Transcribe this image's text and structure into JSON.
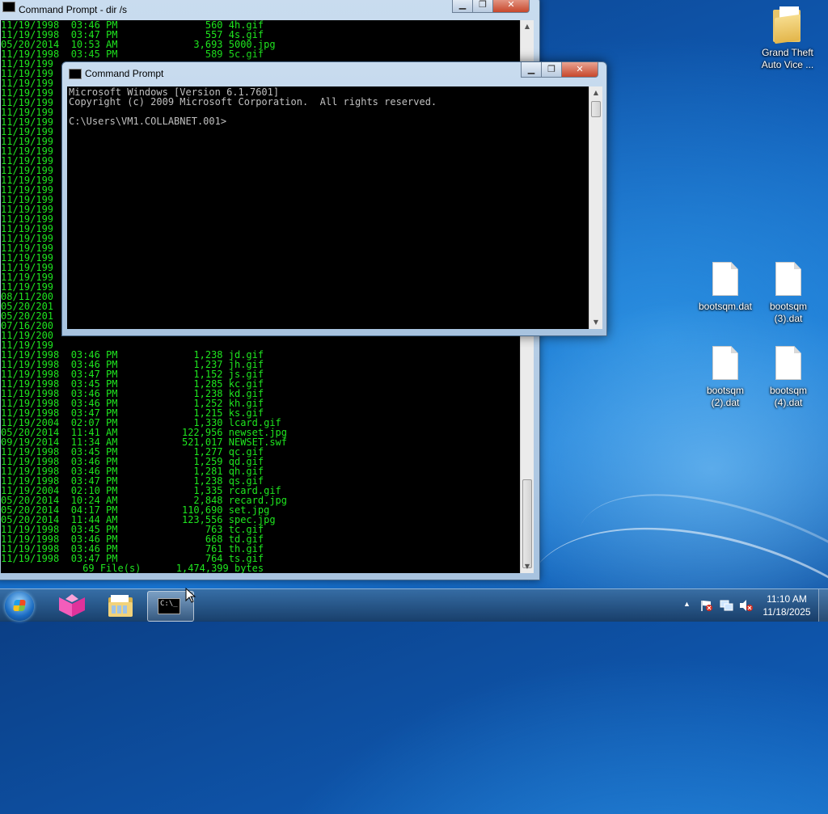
{
  "desktop": {
    "icons": [
      {
        "name": "folder-gta",
        "label": "Grand Theft Auto Vice ..."
      },
      {
        "name": "file-bootsqm",
        "label": "bootsqm.dat"
      },
      {
        "name": "file-bootsqm-3",
        "label": "bootsqm (3).dat"
      },
      {
        "name": "file-bootsqm-2",
        "label": "bootsqm (2).dat"
      },
      {
        "name": "file-bootsqm-4",
        "label": "bootsqm (4).dat"
      }
    ]
  },
  "window_back": {
    "title": "Command Prompt - dir /s",
    "colors": {
      "text": "#1fe61f",
      "background": "#000000"
    },
    "top_rows": [
      "11/19/1998  03:46 PM               560 4h.gif",
      "11/19/1998  03:47 PM               557 4s.gif",
      "05/20/2014  10:53 AM             3,693 5000.jpg",
      "11/19/1998  03:45 PM               589 5c.gif"
    ],
    "left_stubs": [
      "11/19/199",
      "11/19/199",
      "11/19/199",
      "11/19/199",
      "11/19/199",
      "11/19/199",
      "11/19/199",
      "11/19/199",
      "11/19/199",
      "11/19/199",
      "11/19/199",
      "11/19/199",
      "11/19/199",
      "11/19/199",
      "11/19/199",
      "11/19/199",
      "11/19/199",
      "11/19/199",
      "11/19/199",
      "11/19/199",
      "11/19/199",
      "11/19/199",
      "11/19/199",
      "11/19/199",
      "08/11/200",
      "05/20/201",
      "05/20/201",
      "07/16/200",
      "11/19/200",
      "11/19/199"
    ],
    "bottom_rows": [
      "11/19/1998  03:46 PM             1,238 jd.gif",
      "11/19/1998  03:46 PM             1,237 jh.gif",
      "11/19/1998  03:47 PM             1,152 js.gif",
      "11/19/1998  03:45 PM             1,285 kc.gif",
      "11/19/1998  03:46 PM             1,238 kd.gif",
      "11/19/1998  03:46 PM             1,252 kh.gif",
      "11/19/1998  03:47 PM             1,215 ks.gif",
      "11/19/2004  02:07 PM             1,330 lcard.gif",
      "05/20/2014  11:41 AM           122,956 newset.jpg",
      "09/19/2014  11:34 AM           521,017 NEWSET.swf",
      "11/19/1998  03:45 PM             1,277 qc.gif",
      "11/19/1998  03:46 PM             1,259 qd.gif",
      "11/19/1998  03:46 PM             1,281 qh.gif",
      "11/19/1998  03:47 PM             1,238 qs.gif",
      "11/19/2004  02:10 PM             1,335 rcard.gif",
      "05/20/2014  10:24 AM             2,848 recard.jpg",
      "05/20/2014  04:17 PM           110,690 set.jpg",
      "05/20/2014  11:44 AM           123,556 spec.jpg",
      "11/19/1998  03:45 PM               763 tc.gif",
      "11/19/1998  03:46 PM               668 td.gif",
      "11/19/1998  03:46 PM               761 th.gif",
      "11/19/1998  03:47 PM               764 ts.gif",
      "              69 File(s)      1,474,399 bytes"
    ]
  },
  "window_front": {
    "title": "Command Prompt",
    "lines": [
      "Microsoft Windows [Version 6.1.7601]",
      "Copyright (c) 2009 Microsoft Corporation.  All rights reserved.",
      "",
      "C:\\Users\\VM1.COLLABNET.001>"
    ],
    "colors": {
      "text": "#c0c0c0",
      "background": "#000000"
    }
  },
  "window_controls": {
    "minimize": "▁",
    "maximize": "❐",
    "close": "✕"
  },
  "taskbar": {
    "cmd_icon_text": "C:\\_",
    "clock": {
      "time": "11:10 AM",
      "date": "11/18/2025"
    },
    "tray_chevron": "▲"
  }
}
